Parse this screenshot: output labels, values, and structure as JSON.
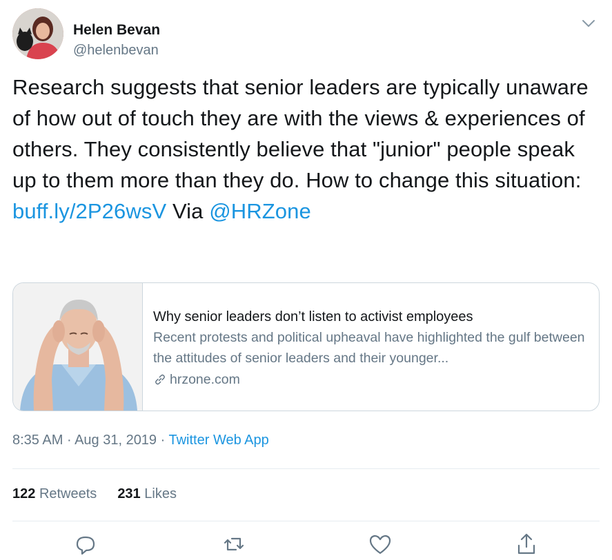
{
  "author": {
    "name": "Helen Bevan",
    "handle": "@helenbevan"
  },
  "tweet": {
    "text_part1": "Research suggests that senior leaders are typically unaware of how out of touch they are with the views & experiences of others. They consistently believe that \"junior\" people speak up to them more than they do. How to change this situation: ",
    "link": "buff.ly/2P26wsV",
    "text_part2": " Via ",
    "mention": "@HRZone"
  },
  "card": {
    "title": "Why senior leaders don’t listen to activist employees",
    "description": "Recent protests and political upheaval have highlighted the gulf between the attitudes of senior leaders and their younger...",
    "domain": "hrzone.com"
  },
  "meta": {
    "time": "8:35 AM",
    "sep1": " · ",
    "date": "Aug 31, 2019",
    "sep2": " · ",
    "source": "Twitter Web App"
  },
  "stats": {
    "retweets_count": "122",
    "retweets_label": "Retweets",
    "likes_count": "231",
    "likes_label": "Likes"
  },
  "icons": [
    "chevron-down-icon",
    "link-icon",
    "reply-icon",
    "retweet-icon",
    "like-icon",
    "share-icon"
  ],
  "colors": {
    "link": "#1b95e0",
    "secondary": "#657786",
    "primary": "#14171a",
    "border": "#ccd6dd"
  }
}
